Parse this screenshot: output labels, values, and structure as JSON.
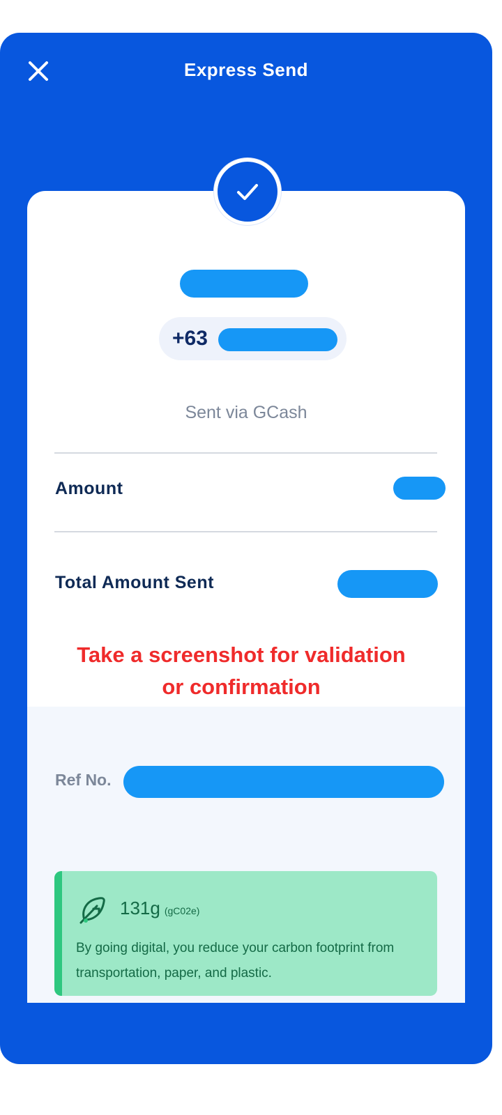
{
  "header": {
    "title": "Express Send",
    "close_icon": "close-icon"
  },
  "receipt": {
    "status_icon": "check-icon",
    "phone_prefix": "+63",
    "sent_via": "Sent via GCash",
    "amount_label": "Amount",
    "total_label": "Total Amount Sent",
    "notice_line1": "Take a screenshot for validation",
    "notice_line2": "or confirmation",
    "ref_label": "Ref No."
  },
  "eco": {
    "icon": "leaf-icon",
    "amount": "131g",
    "unit": "(gC02e)",
    "message": "By going digital, you reduce your carbon footprint from transportation, paper, and plastic."
  },
  "colors": {
    "brand_blue": "#0857de",
    "redaction": "#1697f6",
    "notice_red": "#ef2b2b",
    "eco_green_bg": "#9de8c7",
    "eco_green_accent": "#2ec77f"
  }
}
